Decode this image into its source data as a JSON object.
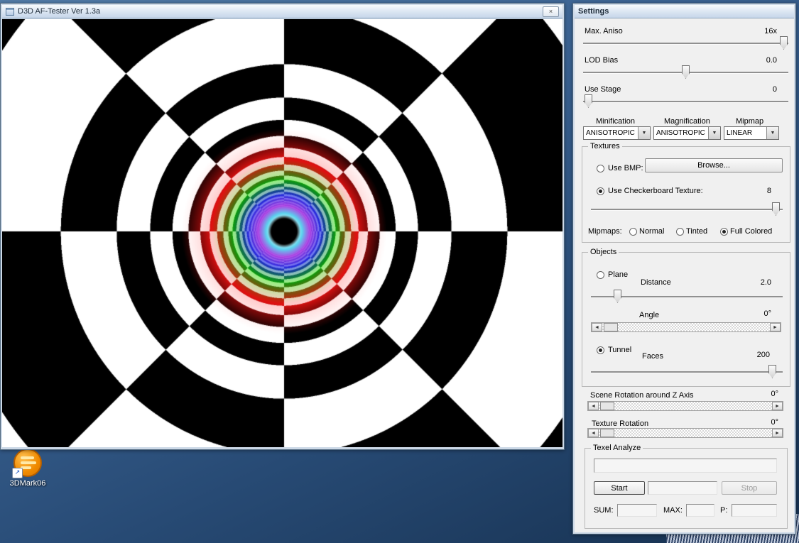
{
  "desktop": {
    "icon_label": "3DMark06"
  },
  "main_window": {
    "title": "D3D AF-Tester Ver 1.3a"
  },
  "icons": {
    "close": "×",
    "dropdown": "▼",
    "arrow_left": "◄",
    "arrow_right": "►",
    "shortcut_arrow": "↗"
  },
  "settings": {
    "title": "Settings",
    "max_aniso": {
      "label": "Max. Aniso",
      "value": "16x"
    },
    "lod_bias": {
      "label": "LOD Bias",
      "value": "0.0"
    },
    "use_stage": {
      "label": "Use Stage",
      "value": "0"
    },
    "filter_columns": {
      "minification": "Minification",
      "magnification": "Magnification",
      "mipmap": "Mipmap"
    },
    "filter_values": {
      "minification": "ANISOTROPIC",
      "magnification": "ANISOTROPIC",
      "mipmap": "LINEAR"
    },
    "textures": {
      "title": "Textures",
      "use_bmp_label": "Use BMP:",
      "browse_label": "Browse...",
      "checkerboard_label": "Use Checkerboard Texture:",
      "checkerboard_value": "8",
      "mipmaps_label": "Mipmaps:",
      "mipmap_options": {
        "normal": "Normal",
        "tinted": "Tinted",
        "full_colored": "Full Colored"
      },
      "selected_mipmap": "Full Colored"
    },
    "objects": {
      "title": "Objects",
      "plane_label": "Plane",
      "distance_label": "Distance",
      "distance_value": "2.0",
      "angle_label": "Angle",
      "angle_value": "0°",
      "tunnel_label": "Tunnel",
      "faces_label": "Faces",
      "faces_value": "200",
      "selected_object": "Tunnel"
    },
    "scene_rotation": {
      "label": "Scene Rotation around Z Axis",
      "value": "0°"
    },
    "texture_rotation": {
      "label": "Texture Rotation",
      "value": "0°"
    },
    "texel_analyze": {
      "title": "Texel Analyze",
      "start_label": "Start",
      "stop_label": "Stop",
      "sum_label": "SUM:",
      "max_label": "MAX:",
      "p_label": "P:",
      "field_value": "",
      "mid_field_value": "",
      "sum_value": "",
      "max_value": "",
      "p_value": ""
    }
  },
  "render": {
    "description": "anisotropic-filtering tunnel test pattern with full-colored mipmaps",
    "background": "#ffffff",
    "sectors": 8,
    "ring_constant": 943,
    "mip_bias": 14.35,
    "hole_radius": 18,
    "center_hole_color": "#000000",
    "mip_levels": [
      {
        "name": "base",
        "light": "#ffffff",
        "dark": "#000000"
      },
      {
        "name": "mip1-red",
        "light": "#ffc8c8",
        "dark": "#e01010"
      },
      {
        "name": "mip2-green",
        "light": "#96f080",
        "dark": "#0c9a0c"
      },
      {
        "name": "mip3-blue",
        "light": "#7a86f5",
        "dark": "#1a1ad8"
      },
      {
        "name": "mip4-magenta",
        "light": "#d27af5",
        "dark": "#8c14d2"
      },
      {
        "name": "mip5-cyan",
        "light": "#a0f0ff",
        "dark": "#14b4dc"
      },
      {
        "name": "mip6-white",
        "light": "#eeffff",
        "dark": "#b4e6f0"
      }
    ]
  }
}
